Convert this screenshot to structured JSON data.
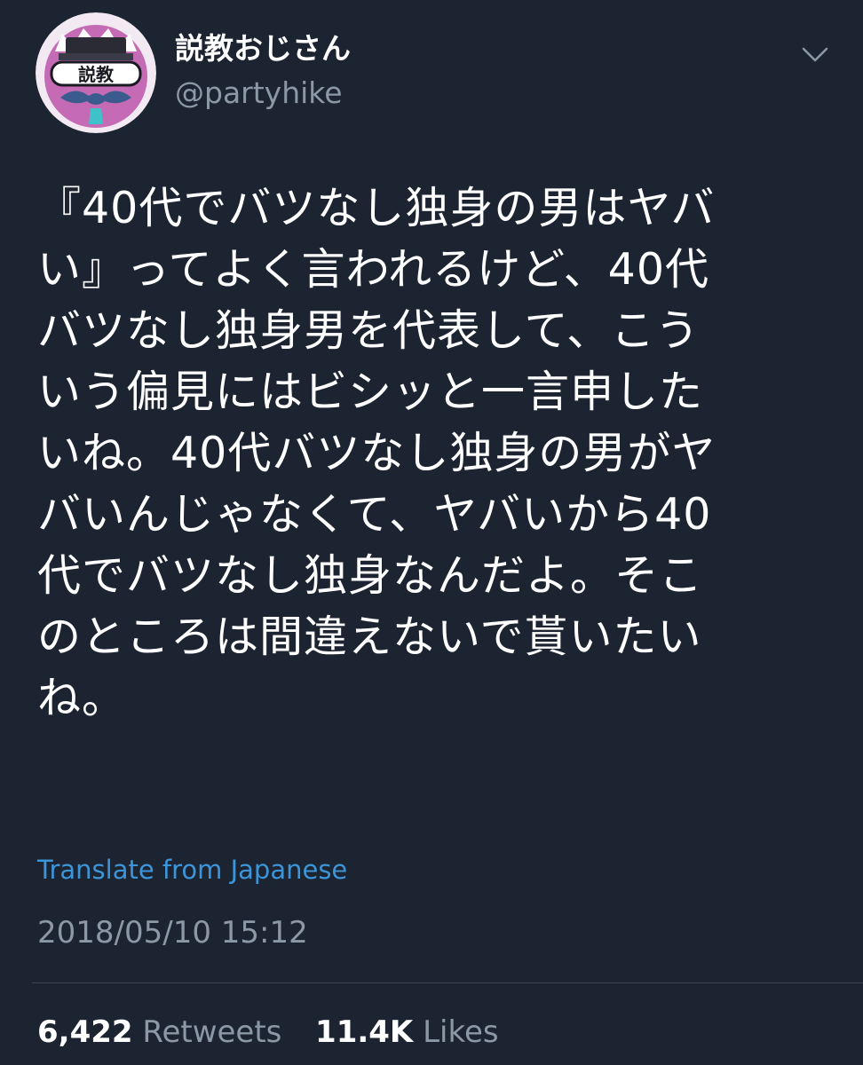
{
  "user": {
    "display_name": "説教おじさん",
    "handle": "@partyhike",
    "avatar_text": "説教"
  },
  "tweet": {
    "lines": [
      "『40代でバツなし独身の男はヤバ",
      "い』ってよく言われるけど、40代",
      "バツなし独身男を代表して、こう",
      "いう偏見にはビシッと一言申した",
      "いね。40代バツなし独身の男がヤ",
      "バいんじゃなくて、ヤバいから40",
      "代でバツなし独身なんだよ。そこ",
      "のところは間違えないで貰いたい",
      "ね。"
    ],
    "translate_label": "Translate from Japanese",
    "timestamp": "2018/05/10 15:12"
  },
  "stats": {
    "retweets_count": "6,422",
    "retweets_label": "Retweets",
    "likes_count": "11.4K",
    "likes_label": "Likes"
  },
  "colors": {
    "background": "#1c2331",
    "text": "#ffffff",
    "secondary_text": "#8b98a5",
    "link": "#3c95d8",
    "divider": "#38444d"
  },
  "icons": {
    "menu": "chevron-down-icon"
  }
}
